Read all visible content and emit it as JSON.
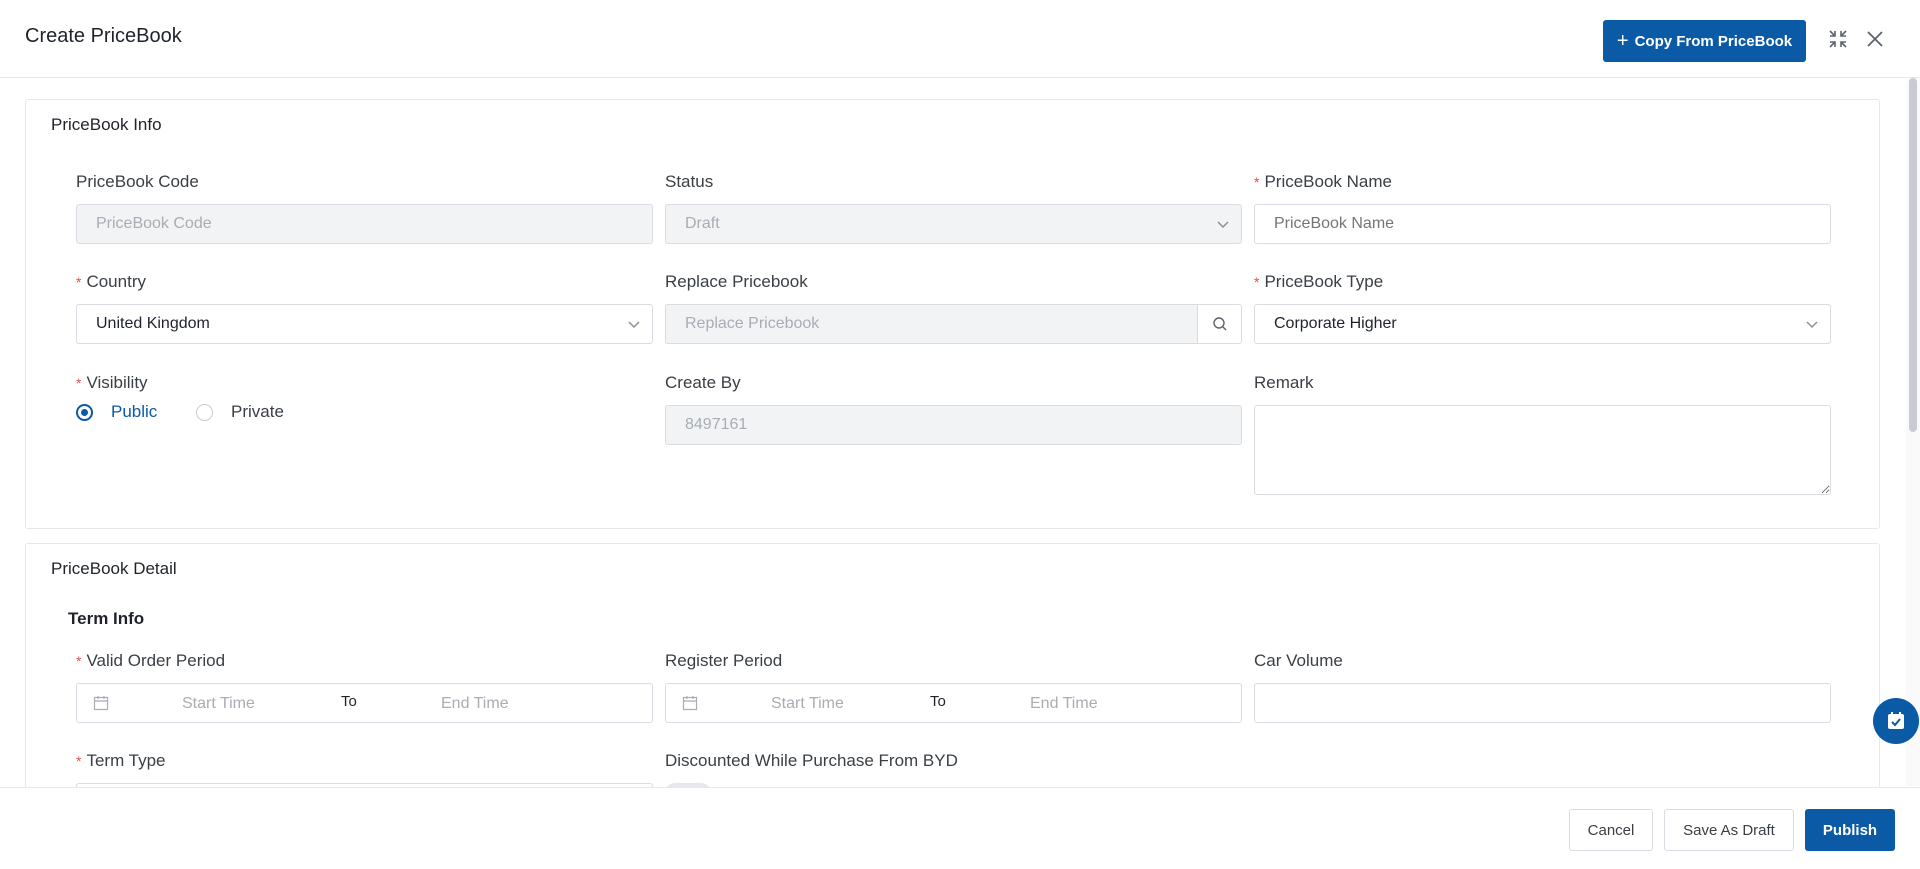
{
  "header": {
    "title": "Create PriceBook",
    "copy_button": "Copy From PriceBook"
  },
  "pricebook_info": {
    "title": "PriceBook Info",
    "code": {
      "label": "PriceBook Code",
      "placeholder": "PriceBook Code"
    },
    "status": {
      "label": "Status",
      "value": "Draft"
    },
    "name": {
      "label": "PriceBook Name",
      "placeholder": "PriceBook Name"
    },
    "country": {
      "label": "Country",
      "value": "United Kingdom"
    },
    "replace": {
      "label": "Replace Pricebook",
      "placeholder": "Replace Pricebook"
    },
    "type": {
      "label": "PriceBook Type",
      "value": "Corporate Higher"
    },
    "visibility": {
      "label": "Visibility",
      "options": [
        "Public",
        "Private"
      ],
      "selected": "Public"
    },
    "create_by": {
      "label": "Create By",
      "value": "8497161"
    },
    "remark": {
      "label": "Remark",
      "value": ""
    }
  },
  "pricebook_detail": {
    "title": "PriceBook Detail",
    "term_info": "Term Info",
    "valid_order_period": {
      "label": "Valid Order Period",
      "start_placeholder": "Start Time",
      "separator": "To",
      "end_placeholder": "End Time"
    },
    "register_period": {
      "label": "Register Period",
      "start_placeholder": "Start Time",
      "separator": "To",
      "end_placeholder": "End Time"
    },
    "car_volume": {
      "label": "Car Volume",
      "value": ""
    },
    "term_type": {
      "label": "Term Type"
    },
    "discounted": {
      "label": "Discounted While Purchase From BYD",
      "enabled": false
    }
  },
  "footer": {
    "cancel": "Cancel",
    "save_draft": "Save As Draft",
    "publish": "Publish"
  },
  "colors": {
    "primary": "#0b5aa6",
    "required": "#e34d4d",
    "disabled_bg": "#f2f3f5"
  }
}
